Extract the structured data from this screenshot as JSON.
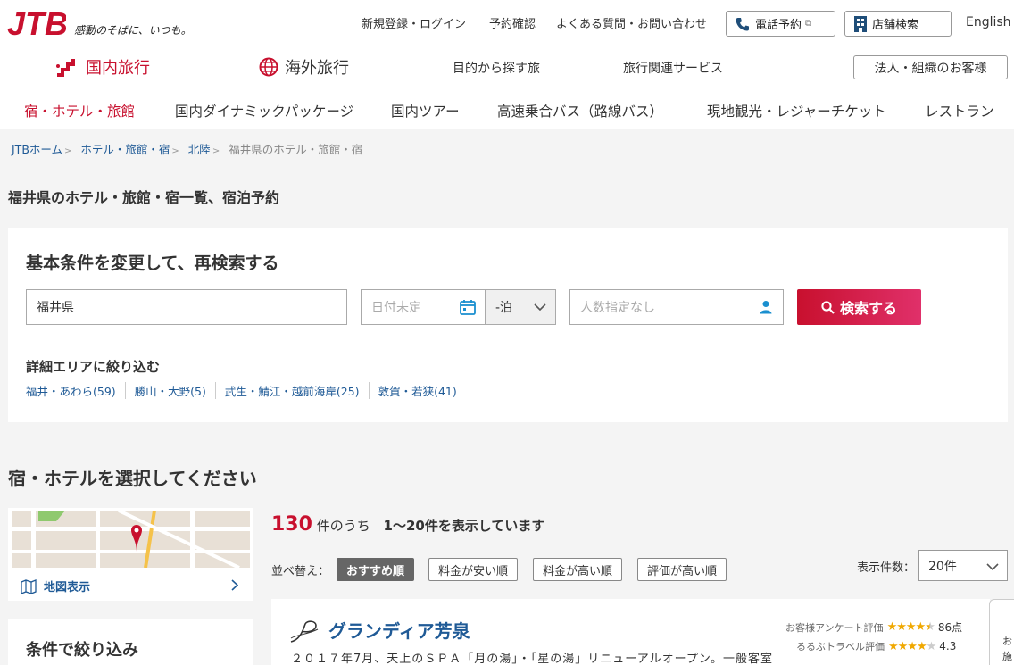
{
  "header": {
    "brand": "JTB",
    "tagline": "感動のそばに、いつも。",
    "utility_links": [
      "新規登録・ログイン",
      "予約確認",
      "よくある質問・お問い合わせ"
    ],
    "phone_button": "電話予約",
    "store_button": "店舗検索",
    "language": "English",
    "brand_color": "#c8102e"
  },
  "global_nav": {
    "domestic": "国内旅行",
    "overseas": "海外旅行",
    "purpose": "目的から探す旅",
    "services": "旅行関連サービス",
    "corporate": "法人・組織のお客様"
  },
  "sub_nav": [
    "宿・ホテル・旅館",
    "国内ダイナミックパッケージ",
    "国内ツアー",
    "高速乗合バス（路線バス）",
    "現地観光・レジャーチケット",
    "レストラン"
  ],
  "breadcrumb": {
    "items": [
      "JTBホーム",
      "ホテル・旅館・宿",
      "北陸"
    ],
    "current": "福井県のホテル・旅館・宿"
  },
  "page_title": "福井県のホテル・旅館・宿一覧、宿泊予約",
  "search": {
    "title": "基本条件を変更して、再検索する",
    "destination": "福井県",
    "date_placeholder": "日付未定",
    "nights": "-泊",
    "guests_placeholder": "人数指定なし",
    "submit": "検索する",
    "area_title": "詳細エリアに絞り込む",
    "areas": [
      "福井・あわら(59)",
      "勝山・大野(5)",
      "武生・鯖江・越前海岸(25)",
      "敦賀・若狭(41)"
    ]
  },
  "results": {
    "section_title": "宿・ホテルを選択してください",
    "map_label": "地図表示",
    "filter_title": "条件で絞り込み",
    "total": "130",
    "total_suffix": "件のうち",
    "range": "1〜20件を表示しています",
    "sort_label": "並べ替え：",
    "sort_options": [
      "おすすめ順",
      "料金が安い順",
      "料金が高い順",
      "評価が高い順"
    ],
    "per_page_label": "表示件数：",
    "per_page": "20件"
  },
  "hotel": {
    "name": "グランディア芳泉",
    "description": "２０１７年7月、天上のＳＰＡ「月の湯」・「星の湯」リニューアルオープン。一般客室",
    "rating1_label": "お客様アンケート評価",
    "rating1_value": "86点",
    "rating1_stars": 4.5,
    "rating2_label": "るるぶトラベル評価",
    "rating2_value": "4.3",
    "rating2_stars": 4.3
  },
  "side_tab": [
    "お",
    "施"
  ]
}
